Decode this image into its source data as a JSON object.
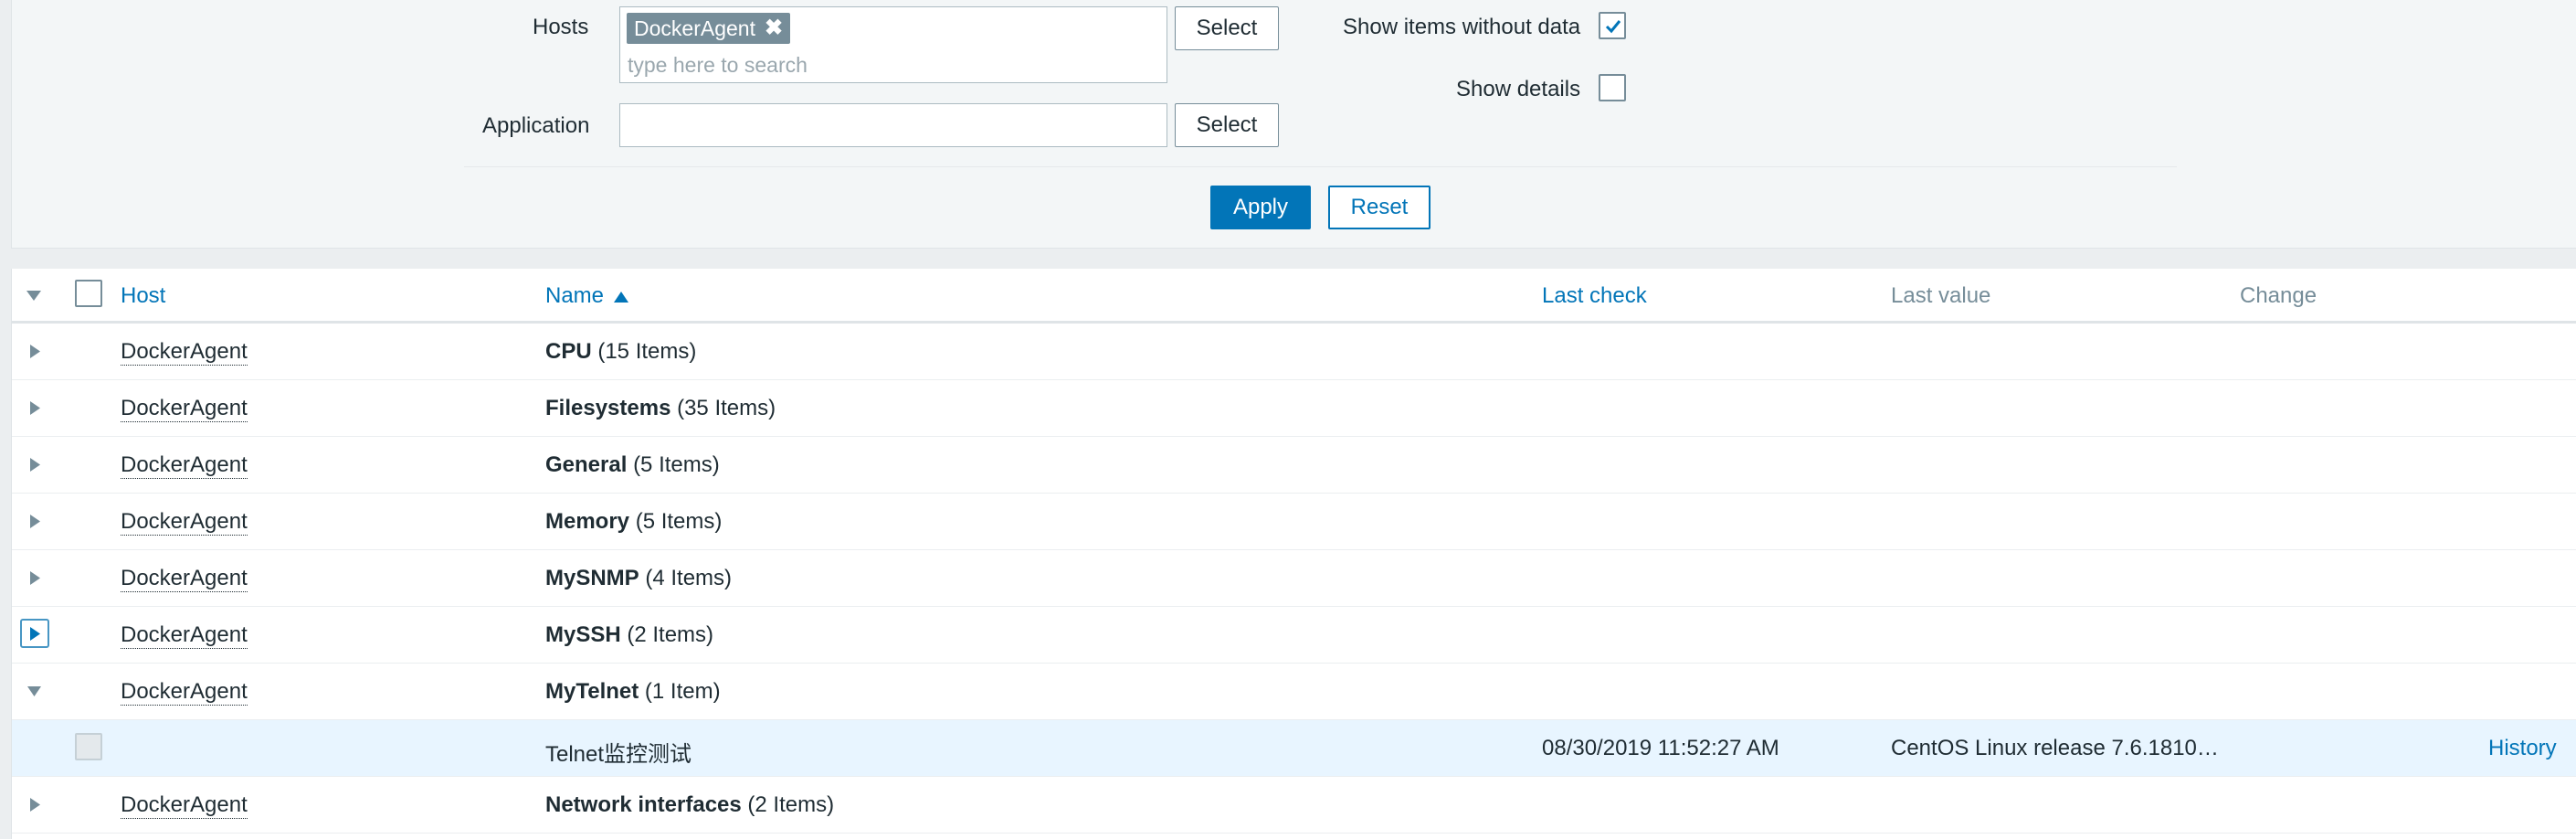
{
  "filter": {
    "hosts_label": "Hosts",
    "hosts_chip": "DockerAgent",
    "hosts_placeholder": "type here to search",
    "hosts_select": "Select",
    "application_label": "Application",
    "application_value": "",
    "application_select": "Select",
    "show_items_without_data_label": "Show items without data",
    "show_items_without_data_checked": true,
    "show_details_label": "Show details",
    "show_details_checked": false,
    "apply": "Apply",
    "reset": "Reset"
  },
  "table": {
    "columns": {
      "host": "Host",
      "name": "Name",
      "last_check": "Last check",
      "last_value": "Last value",
      "change": "Change"
    },
    "rows": [
      {
        "host": "DockerAgent",
        "app": "CPU",
        "count": "(15 Items)",
        "expanded": false
      },
      {
        "host": "DockerAgent",
        "app": "Filesystems",
        "count": "(35 Items)",
        "expanded": false
      },
      {
        "host": "DockerAgent",
        "app": "General",
        "count": "(5 Items)",
        "expanded": false
      },
      {
        "host": "DockerAgent",
        "app": "Memory",
        "count": "(5 Items)",
        "expanded": false
      },
      {
        "host": "DockerAgent",
        "app": "MySNMP",
        "count": "(4 Items)",
        "expanded": false
      },
      {
        "host": "DockerAgent",
        "app": "MySSH",
        "count": "(2 Items)",
        "expanded": false
      },
      {
        "host": "DockerAgent",
        "app": "MyTelnet",
        "count": "(1 Item)",
        "expanded": true
      },
      {
        "host": "DockerAgent",
        "app": "Network interfaces",
        "count": "(2 Items)",
        "expanded": false
      }
    ],
    "item": {
      "name": "Telnet监控测试",
      "last_check": "08/30/2019 11:52:27 AM",
      "last_value": "CentOS Linux release 7.6.1810…",
      "history": "History"
    }
  },
  "colors": {
    "accent": "#0275b8",
    "chip": "#768d99",
    "item_row": "#e8f5ff"
  }
}
